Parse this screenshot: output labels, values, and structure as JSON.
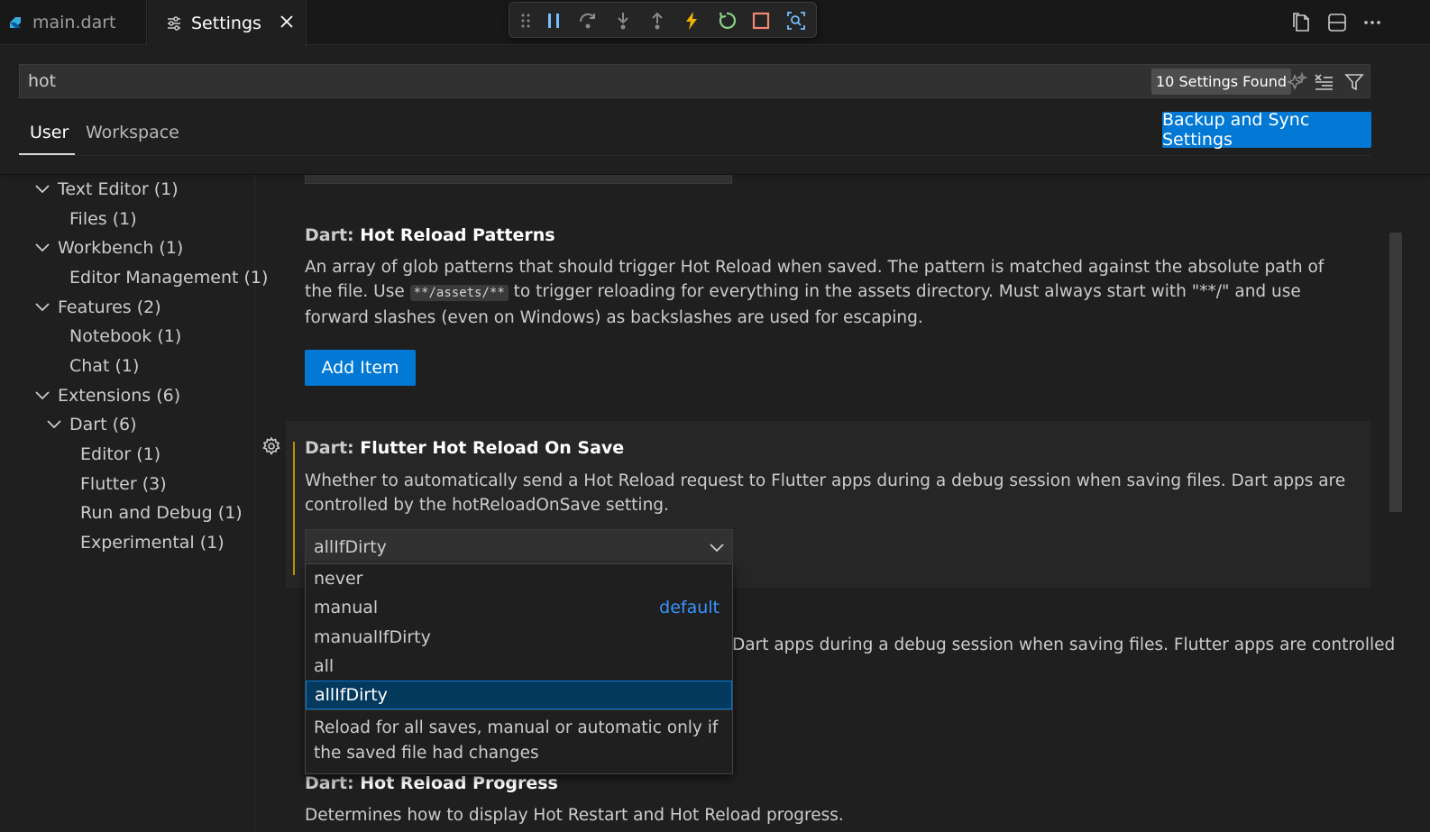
{
  "tabs": [
    {
      "label": "main.dart"
    },
    {
      "label": "Settings"
    }
  ],
  "search": {
    "value": "hot",
    "results_badge": "10 Settings Found"
  },
  "scope_tabs": {
    "user": "User",
    "workspace": "Workspace",
    "backup_button": "Backup and Sync Settings"
  },
  "tree": {
    "items": [
      {
        "label": "Text Editor (1)"
      },
      {
        "label": "Files (1)"
      },
      {
        "label": "Workbench (1)"
      },
      {
        "label": "Editor Management (1)"
      },
      {
        "label": "Features (2)"
      },
      {
        "label": "Notebook (1)"
      },
      {
        "label": "Chat (1)"
      },
      {
        "label": "Extensions (6)"
      },
      {
        "label": "Dart (6)"
      },
      {
        "label": "Editor (1)"
      },
      {
        "label": "Flutter (3)"
      },
      {
        "label": "Run and Debug (1)"
      },
      {
        "label": "Experimental (1)"
      }
    ]
  },
  "settings": {
    "hot_reload_patterns": {
      "category": "Dart: ",
      "name": "Hot Reload Patterns",
      "desc_part1": "An array of glob patterns that should trigger Hot Reload when saved. The pattern is matched against the absolute path of the file. Use ",
      "code": "**/assets/**",
      "desc_part2": " to trigger reloading for everything in the assets directory. Must always start with \"**/\" and use forward slashes (even on Windows) as backslashes are used for escaping.",
      "add_item_label": "Add Item"
    },
    "flutter_hot_reload_on_save": {
      "category": "Dart: ",
      "name": "Flutter Hot Reload On Save",
      "description": "Whether to automatically send a Hot Reload request to Flutter apps during a debug session when saving files. Dart apps are controlled by the hotReloadOnSave setting.",
      "selected_value": "allIfDirty",
      "options": [
        {
          "label": "never"
        },
        {
          "label": "manual",
          "tag": "default"
        },
        {
          "label": "manualIfDirty"
        },
        {
          "label": "all"
        },
        {
          "label": "allIfDirty"
        }
      ],
      "option_description": "Reload for all saves, manual or automatic only if the saved file had changes"
    },
    "hot_reload_on_save_partial": {
      "description_fragment": "Dart apps during a debug session when saving files. Flutter apps are controlled"
    },
    "hot_reload_progress": {
      "category": "Dart: ",
      "name": "Hot Reload Progress",
      "description": "Determines how to display Hot Restart and Hot Reload progress."
    }
  },
  "colors": {
    "accent": "#0078d4",
    "focus_bar": "#b89500",
    "default_tag": "#3794ff"
  }
}
